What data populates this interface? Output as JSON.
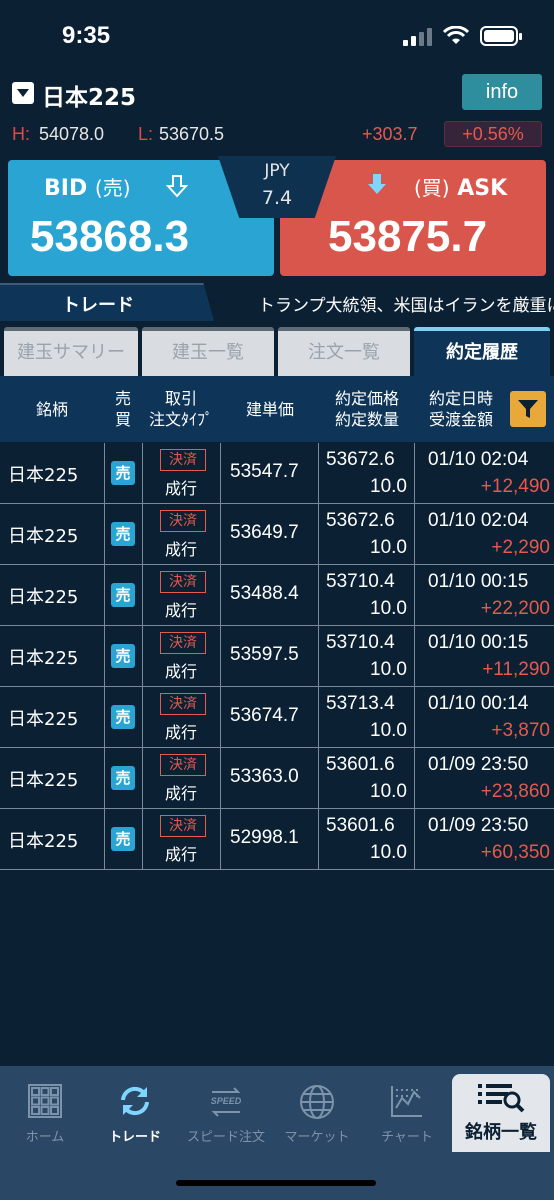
{
  "status": {
    "time": "9:35"
  },
  "symbol": {
    "name": "日本225",
    "info_label": "info"
  },
  "range": {
    "high_label": "H:",
    "high": "54078.0",
    "low_label": "L:",
    "low": "53670.5",
    "change": "+303.7",
    "change_pct": "+0.56%"
  },
  "quote": {
    "bid_label": "BID",
    "bid_sub": "(売)",
    "bid": "53868.3",
    "ask_label": "ASK",
    "ask_sub": "(買)",
    "ask": "53875.7",
    "currency": "JPY",
    "spread": "7.4"
  },
  "trade_tab": "トレード",
  "ticker": "トランプ大統領、米国はイランを厳重に",
  "subtabs": [
    "建玉サマリー",
    "建玉一覧",
    "注文一覧",
    "約定履歴"
  ],
  "table": {
    "headers": {
      "symbol": "銘柄",
      "side_1": "売",
      "side_2": "買",
      "type_1": "取引",
      "type_2": "注文ﾀｲﾌﾟ",
      "open": "建単価",
      "price_1": "約定価格",
      "price_2": "約定数量",
      "date_1": "約定日時",
      "date_2": "受渡金額"
    },
    "rows": [
      {
        "symbol": "日本225",
        "side": "売",
        "settle": "決済",
        "ordtype": "成行",
        "open": "53547.7",
        "price": "53672.6",
        "qty": "10.0",
        "date": "01/10 02:04",
        "amount": "+12,490"
      },
      {
        "symbol": "日本225",
        "side": "売",
        "settle": "決済",
        "ordtype": "成行",
        "open": "53649.7",
        "price": "53672.6",
        "qty": "10.0",
        "date": "01/10 02:04",
        "amount": "+2,290"
      },
      {
        "symbol": "日本225",
        "side": "売",
        "settle": "決済",
        "ordtype": "成行",
        "open": "53488.4",
        "price": "53710.4",
        "qty": "10.0",
        "date": "01/10 00:15",
        "amount": "+22,200"
      },
      {
        "symbol": "日本225",
        "side": "売",
        "settle": "決済",
        "ordtype": "成行",
        "open": "53597.5",
        "price": "53710.4",
        "qty": "10.0",
        "date": "01/10 00:15",
        "amount": "+11,290"
      },
      {
        "symbol": "日本225",
        "side": "売",
        "settle": "決済",
        "ordtype": "成行",
        "open": "53674.7",
        "price": "53713.4",
        "qty": "10.0",
        "date": "01/10 00:14",
        "amount": "+3,870"
      },
      {
        "symbol": "日本225",
        "side": "売",
        "settle": "決済",
        "ordtype": "成行",
        "open": "53363.0",
        "price": "53601.6",
        "qty": "10.0",
        "date": "01/09 23:50",
        "amount": "+23,860"
      },
      {
        "symbol": "日本225",
        "side": "売",
        "settle": "決済",
        "ordtype": "成行",
        "open": "52998.1",
        "price": "53601.6",
        "qty": "10.0",
        "date": "01/09 23:50",
        "amount": "+60,350"
      }
    ]
  },
  "nav": {
    "home": "ホーム",
    "trade": "トレード",
    "speed": "スピード注文",
    "speed_icon_text": "SPEED",
    "market": "マーケット",
    "chart": "チャート",
    "list": "銘柄一覧"
  },
  "colors": {
    "bid": "#2aa4d3",
    "ask": "#d9564c",
    "positive": "#e55a4d",
    "background": "#0b2033"
  }
}
